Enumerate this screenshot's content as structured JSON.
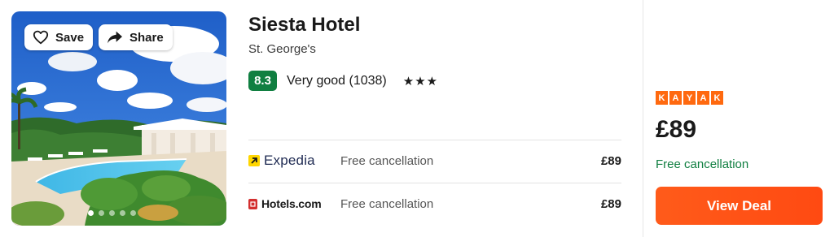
{
  "listing": {
    "photo": {
      "save_label": "Save",
      "share_label": "Share",
      "save_icon": "heart-icon",
      "share_icon": "share-arrow-icon",
      "slide_count": 5,
      "active_slide": 1
    },
    "name": "Siesta Hotel",
    "location": "St. George's",
    "rating": {
      "score": "8.3",
      "label": "Very good (1038)",
      "stars_text": "★★★",
      "star_count": 3,
      "score_color": "#107f41"
    },
    "providers": [
      {
        "name": "Expedia",
        "cancellation": "Free cancellation",
        "price": "£89"
      },
      {
        "name": "Hotels.com",
        "cancellation": "Free cancellation",
        "price": "£89"
      }
    ],
    "deal": {
      "brand_letters": [
        "K",
        "A",
        "Y",
        "A",
        "K"
      ],
      "price": "£89",
      "cancellation": "Free cancellation",
      "cta_label": "View Deal",
      "accent_color": "#ff690f",
      "cancellation_color": "#107f41"
    }
  }
}
